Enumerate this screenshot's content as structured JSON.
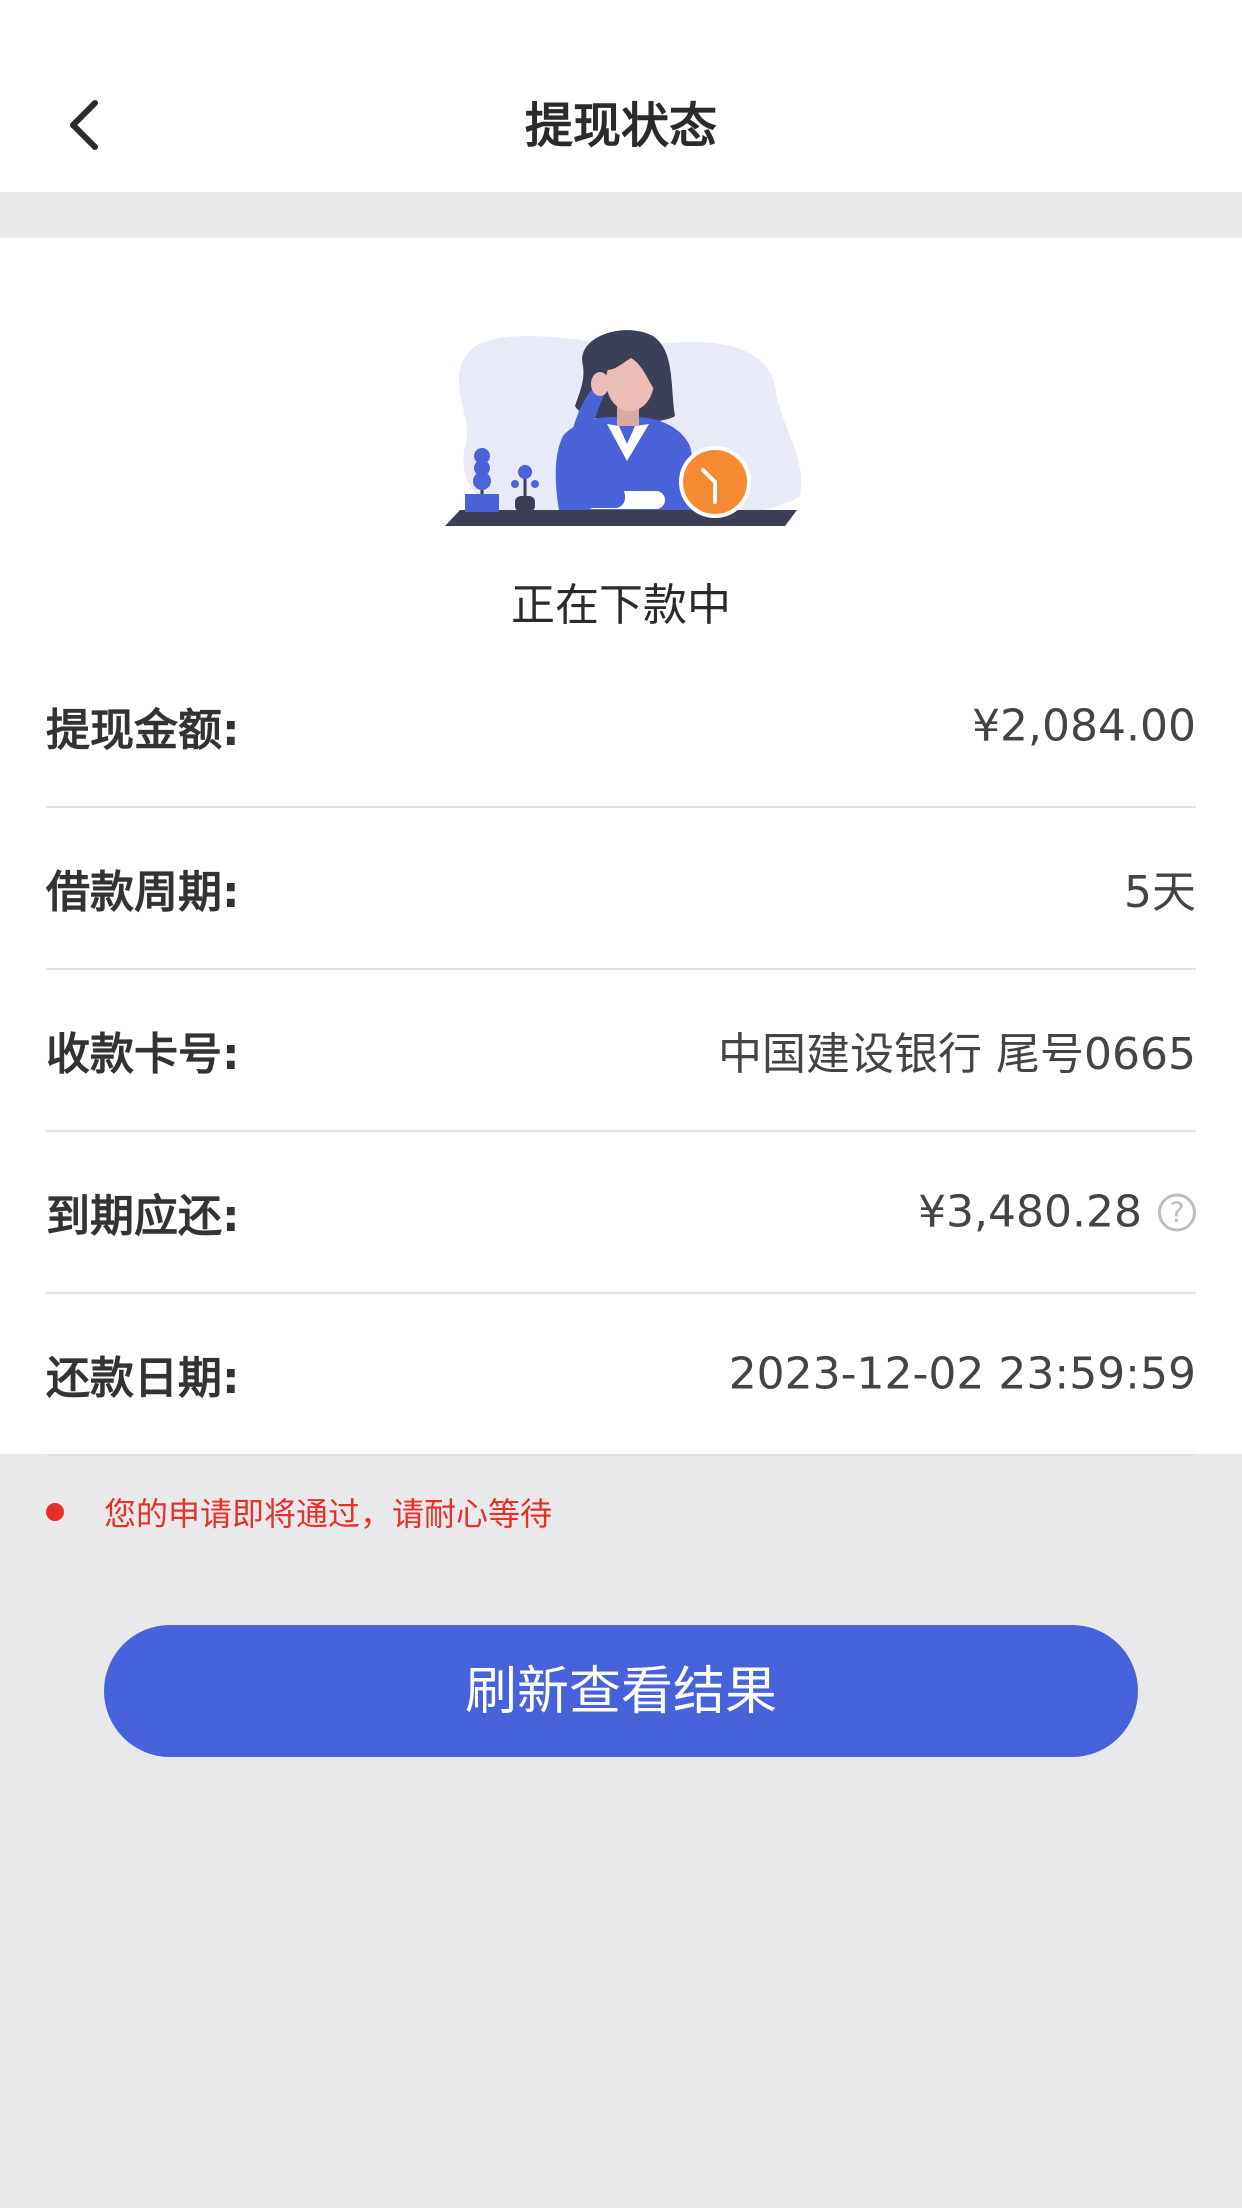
{
  "header": {
    "title": "提现状态"
  },
  "status": {
    "text": "正在下款中"
  },
  "details": [
    {
      "label": "提现金额:",
      "value": "¥2,084.00"
    },
    {
      "label": "借款周期:",
      "value": "5天"
    },
    {
      "label": "收款卡号:",
      "value": "中国建设银行 尾号0665"
    },
    {
      "label": "到期应还:",
      "value": "¥3,480.28"
    },
    {
      "label": "还款日期:",
      "value": "2023-12-02 23:59:59"
    }
  ],
  "help_symbol": "?",
  "notice": {
    "text": "您的申请即将通过，请耐心等待",
    "color": "#e53229"
  },
  "action": {
    "refresh_label": "刷新查看结果",
    "color": "#4763db"
  }
}
